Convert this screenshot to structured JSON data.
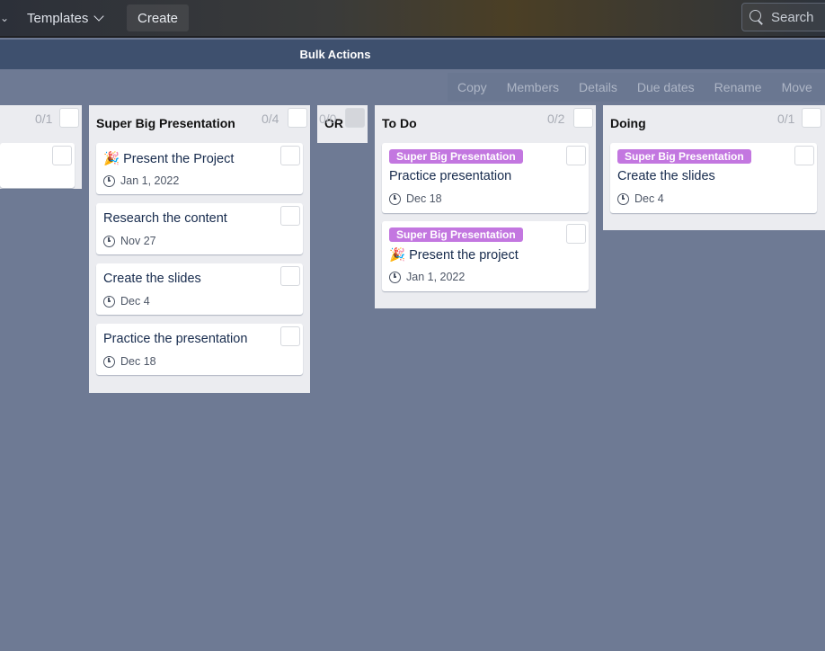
{
  "nav": {
    "templates_label": "Templates",
    "create_label": "Create",
    "search_placeholder": "Search"
  },
  "bulk": {
    "title": "Bulk Actions",
    "actions": [
      "Copy",
      "Members",
      "Details",
      "Due dates",
      "Rename",
      "Move"
    ]
  },
  "colors": {
    "board_bg": "#6e7a94",
    "label_purple": "#c377e0",
    "bulkbar": "#3e506e"
  },
  "lists": [
    {
      "title": "",
      "count": "0/1",
      "cards": [
        {
          "title": ""
        }
      ]
    },
    {
      "title": "Super Big Presentation",
      "count": "0/4",
      "cards": [
        {
          "emoji": "🎉",
          "title": "Present the Project",
          "due": "Jan 1, 2022"
        },
        {
          "title": "Research the content",
          "due": "Nov 27"
        },
        {
          "title": "Create the slides",
          "due": "Dec 4"
        },
        {
          "title": "Practice the presentation",
          "due": "Dec 18"
        }
      ]
    },
    {
      "title": "OR",
      "count": "0/0",
      "cards": []
    },
    {
      "title": "To Do",
      "count": "0/2",
      "cards": [
        {
          "label": "Super Big Presentation",
          "title": "Practice presentation",
          "due": "Dec 18"
        },
        {
          "label": "Super Big Presentation",
          "emoji": "🎉",
          "title": "Present the project",
          "due": "Jan 1, 2022"
        }
      ]
    },
    {
      "title": "Doing",
      "count": "0/1",
      "cards": [
        {
          "label": "Super Big Presentation",
          "title": "Create the slides",
          "due": "Dec 4"
        }
      ]
    }
  ]
}
